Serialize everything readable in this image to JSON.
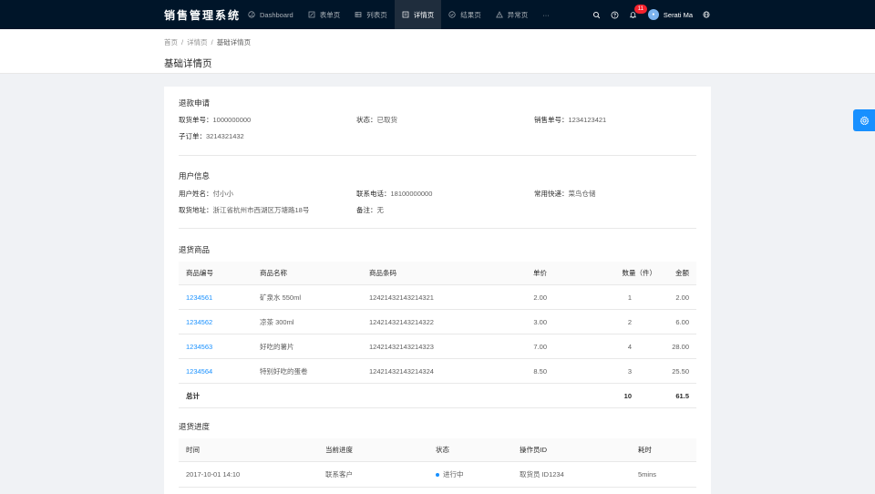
{
  "header": {
    "logo": "销售管理系统",
    "nav": [
      {
        "label": "Dashboard",
        "icon": "dashboard-icon",
        "active": false
      },
      {
        "label": "表单页",
        "icon": "form-icon",
        "active": false
      },
      {
        "label": "列表页",
        "icon": "table-icon",
        "active": false
      },
      {
        "label": "详情页",
        "icon": "profile-icon",
        "active": true
      },
      {
        "label": "结果页",
        "icon": "check-circle-icon",
        "active": false
      },
      {
        "label": "异常页",
        "icon": "warning-icon",
        "active": false
      },
      {
        "label": "···",
        "icon": "more-icon",
        "active": false
      }
    ],
    "notification_count": "11",
    "user_name": "Serati Ma"
  },
  "breadcrumb": [
    "首页",
    "详情页",
    "基础详情页"
  ],
  "page_title": "基础详情页",
  "refund": {
    "title": "退款申请",
    "fields": [
      {
        "label": "取货单号：",
        "value": "1000000000"
      },
      {
        "label": "状态：",
        "value": "已取货"
      },
      {
        "label": "销售单号：",
        "value": "1234123421"
      },
      {
        "label": "子订单：",
        "value": "3214321432"
      }
    ]
  },
  "user_info": {
    "title": "用户信息",
    "fields": [
      {
        "label": "用户姓名：",
        "value": "付小小"
      },
      {
        "label": "联系电话：",
        "value": "18100000000"
      },
      {
        "label": "常用快递：",
        "value": "菜鸟仓储"
      },
      {
        "label": "取货地址：",
        "value": "浙江省杭州市西湖区万塘路18号"
      },
      {
        "label": "备注：",
        "value": "无"
      }
    ]
  },
  "goods": {
    "title": "退货商品",
    "columns": [
      "商品编号",
      "商品名称",
      "商品条码",
      "单价",
      "数量（件）",
      "金额"
    ],
    "rows": [
      {
        "id": "1234561",
        "name": "矿泉水 550ml",
        "barcode": "12421432143214321",
        "price": "2.00",
        "qty": "1",
        "amount": "2.00"
      },
      {
        "id": "1234562",
        "name": "凉茶 300ml",
        "barcode": "12421432143214322",
        "price": "3.00",
        "qty": "2",
        "amount": "6.00"
      },
      {
        "id": "1234563",
        "name": "好吃的薯片",
        "barcode": "12421432143214323",
        "price": "7.00",
        "qty": "4",
        "amount": "28.00"
      },
      {
        "id": "1234564",
        "name": "特别好吃的蛋卷",
        "barcode": "12421432143214324",
        "price": "8.50",
        "qty": "3",
        "amount": "25.50"
      }
    ],
    "total": {
      "label": "总计",
      "qty": "10",
      "amount": "61.5"
    }
  },
  "progress": {
    "title": "退货进度",
    "columns": [
      "时间",
      "当前进度",
      "状态",
      "操作员ID",
      "耗时"
    ],
    "rows": [
      {
        "time": "2017-10-01 14:10",
        "step": "联系客户",
        "status": "进行中",
        "operator": "取货员 ID1234",
        "duration": "5mins"
      }
    ]
  },
  "colors": {
    "header_bg": "#001529",
    "primary": "#1890ff",
    "badge": "#f5222d"
  }
}
